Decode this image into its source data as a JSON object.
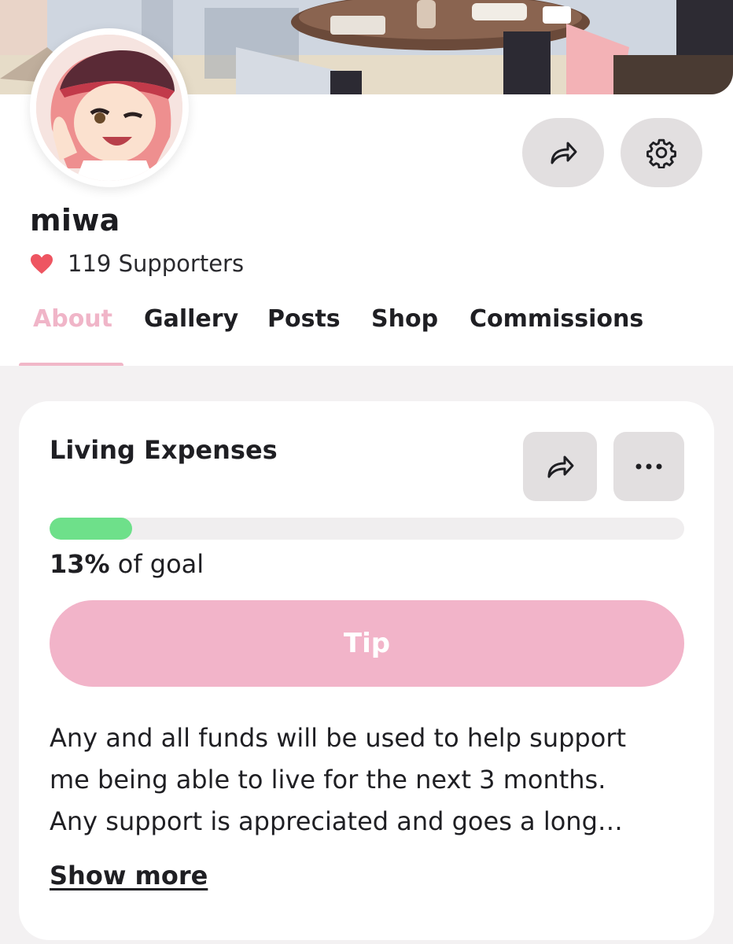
{
  "profile": {
    "username": "miwa",
    "supporters_text": "119 Supporters"
  },
  "tabs": [
    {
      "label": "About",
      "active": true
    },
    {
      "label": "Gallery",
      "active": false
    },
    {
      "label": "Posts",
      "active": false
    },
    {
      "label": "Shop",
      "active": false
    },
    {
      "label": "Commissions",
      "active": false
    }
  ],
  "goal": {
    "title": "Living Expenses",
    "progress_fraction": 0.13,
    "percent_text": "13%",
    "of_goal_text": " of goal",
    "tip_label": "Tip",
    "description_lines": [
      "Any and all funds will be used to help support",
      "me being able to live for the next 3 months.",
      "Any support is appreciated and goes a long…"
    ],
    "show_more_label": "Show more"
  },
  "icons": {
    "share": "share-arrow-icon",
    "settings": "gear-icon",
    "more": "more-dots-icon",
    "heart": "heart-icon"
  },
  "colors": {
    "accent_pink": "#f2b4c9",
    "progress_green": "#6ee08a",
    "heart_red": "#ee5561",
    "button_gray": "#e2dfe0"
  }
}
